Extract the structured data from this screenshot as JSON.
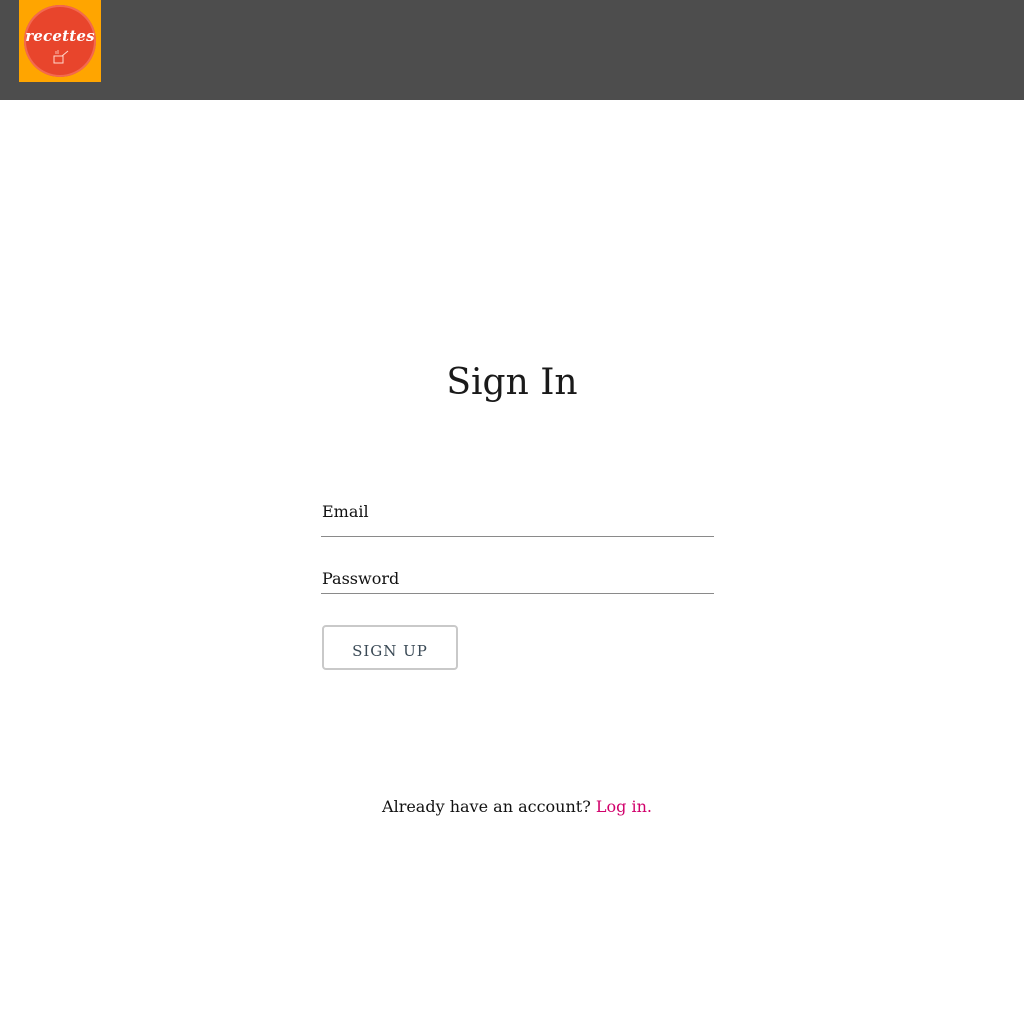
{
  "header": {
    "logo_text": "recettes",
    "colors": {
      "bar": "#4d4d4d",
      "logo_background": "#ffa500",
      "logo_circle": "#e8452c"
    },
    "logo_icon": "cooking-pot-icon"
  },
  "form": {
    "title": "Sign In",
    "email_placeholder": "Email",
    "password_placeholder": "Password",
    "submit_label": "SIGN UP"
  },
  "footer": {
    "prompt_text": "Already have an account?",
    "login_link_text": "Log in.",
    "link_color": "#d1006b"
  }
}
